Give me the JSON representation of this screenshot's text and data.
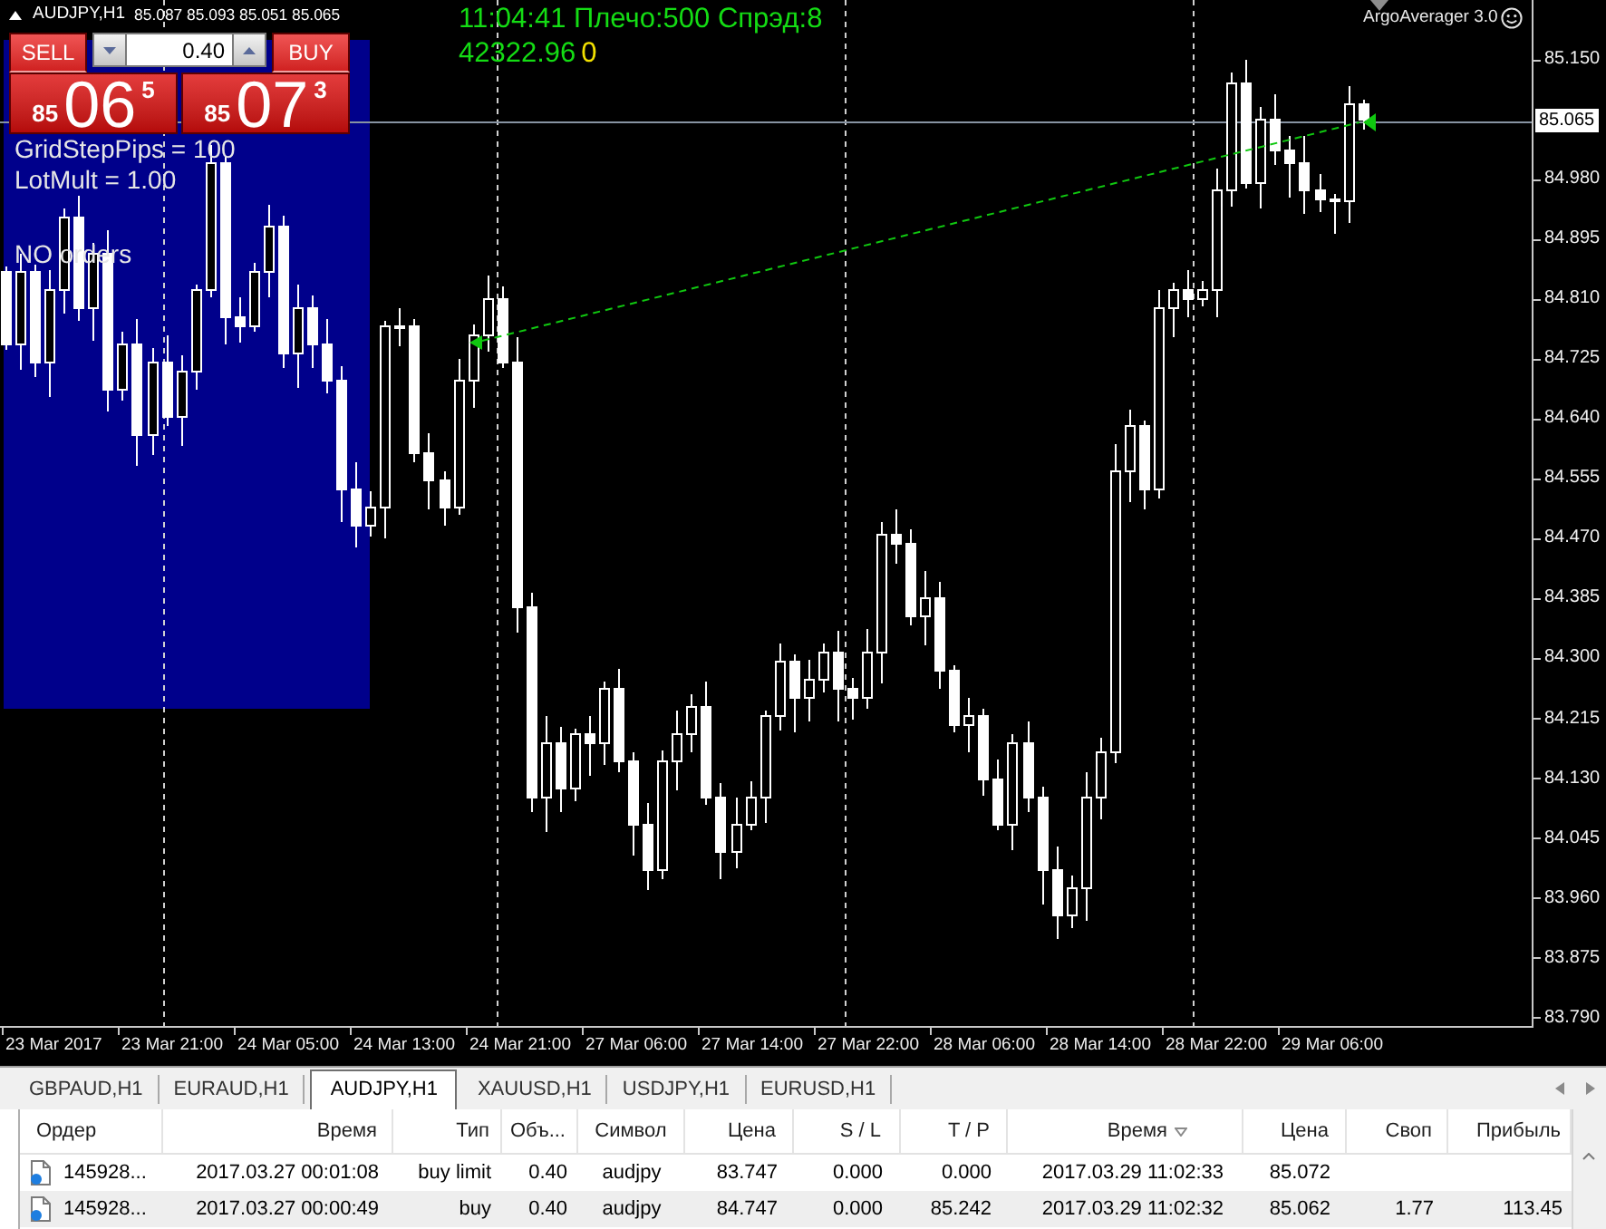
{
  "chart": {
    "header": {
      "symbol": "AUDJPY,H1",
      "quotes": "85.087 85.093 85.051 85.065"
    },
    "status": {
      "text": "11:04:41 Плечо:500 Спрэд:8",
      "balance": "42322.96",
      "count": "0"
    },
    "expert": {
      "name": "ArgoAverager 3.0"
    },
    "trade_panel": {
      "sell": {
        "label": "SELL",
        "price_head": "85",
        "price_main": "06",
        "price_tail": "5"
      },
      "lot": {
        "value": "0.40"
      },
      "buy": {
        "label": "BUY",
        "price_head": "85",
        "price_main": "07",
        "price_tail": "3"
      }
    },
    "info_panel": [
      {
        "text": "GridStepPips = 100",
        "kind": "param"
      },
      {
        "text": "LotMult = 1.00",
        "kind": "param"
      },
      {
        "text": "NO orders",
        "kind": "status"
      }
    ],
    "price_axis": [
      {
        "text": "85.150",
        "kind": "tick"
      },
      {
        "text": "85.065",
        "kind": "current"
      },
      {
        "text": "84.980",
        "kind": "tick"
      },
      {
        "text": "84.895",
        "kind": "tick"
      },
      {
        "text": "84.810",
        "kind": "tick"
      },
      {
        "text": "84.725",
        "kind": "tick"
      },
      {
        "text": "84.640",
        "kind": "tick"
      },
      {
        "text": "84.555",
        "kind": "tick"
      },
      {
        "text": "84.470",
        "kind": "tick"
      },
      {
        "text": "84.385",
        "kind": "tick"
      },
      {
        "text": "84.300",
        "kind": "tick"
      },
      {
        "text": "84.215",
        "kind": "tick"
      },
      {
        "text": "84.130",
        "kind": "tick"
      },
      {
        "text": "84.045",
        "kind": "tick"
      },
      {
        "text": "83.960",
        "kind": "tick"
      },
      {
        "text": "83.875",
        "kind": "tick"
      },
      {
        "text": "83.790",
        "kind": "tick"
      }
    ],
    "time_axis": [
      "23 Mar 2017",
      "23 Mar 21:00",
      "24 Mar 05:00",
      "24 Mar 13:00",
      "24 Mar 21:00",
      "27 Mar 06:00",
      "27 Mar 14:00",
      "27 Mar 22:00",
      "28 Mar 06:00",
      "28 Mar 14:00",
      "28 Mar 22:00",
      "29 Mar 06:00"
    ]
  },
  "tabs": [
    {
      "label": "GBPAUD,H1",
      "selected": false
    },
    {
      "label": "EURAUD,H1",
      "selected": false
    },
    {
      "label": "AUDJPY,H1",
      "selected": true
    },
    {
      "label": "XAUUSD,H1",
      "selected": false
    },
    {
      "label": "USDJPY,H1",
      "selected": false
    },
    {
      "label": "EURUSD,H1",
      "selected": false
    }
  ],
  "orders_table": {
    "columns": [
      {
        "label": "Ордер",
        "sorted": false
      },
      {
        "label": "Время",
        "sorted": false
      },
      {
        "label": "Тип",
        "sorted": false
      },
      {
        "label": "Объ...",
        "sorted": false
      },
      {
        "label": "Символ",
        "sorted": false
      },
      {
        "label": "Цена",
        "sorted": false
      },
      {
        "label": "S / L",
        "sorted": false
      },
      {
        "label": "T / P",
        "sorted": false
      },
      {
        "label": "Время",
        "sorted": true
      },
      {
        "label": "Цена",
        "sorted": false
      },
      {
        "label": "Своп",
        "sorted": false
      },
      {
        "label": "Прибыль",
        "sorted": false
      }
    ],
    "rows": [
      {
        "cells": [
          "145928...",
          "2017.03.27 00:01:08",
          "buy limit",
          "0.40",
          "audjpy",
          "83.747",
          "0.000",
          "0.000",
          "2017.03.29 11:02:33",
          "85.072"
        ]
      },
      {
        "cells": [
          "145928...",
          "2017.03.27 00:00:49",
          "buy",
          "0.40",
          "audjpy",
          "84.747",
          "0.000",
          "85.242",
          "2017.03.29 11:02:32",
          "85.062",
          "1.77",
          "113.45"
        ]
      }
    ]
  }
}
